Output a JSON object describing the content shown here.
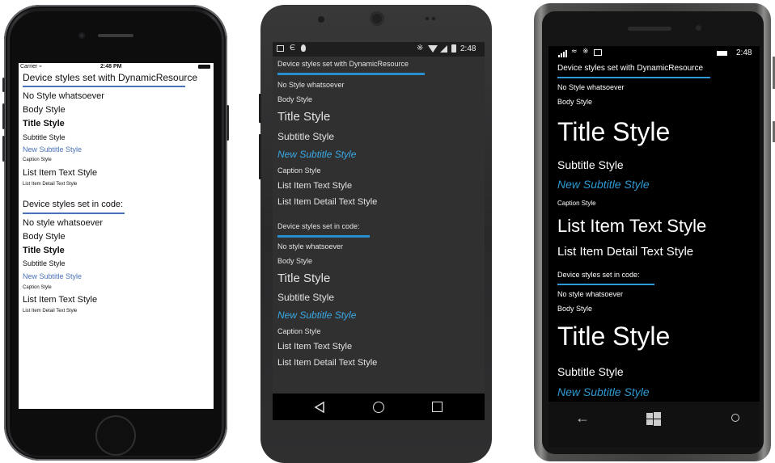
{
  "iphone": {
    "status": {
      "carrier": "Carrier",
      "time": "2:48 PM"
    },
    "section1": {
      "header": "Device styles set with DynamicResource",
      "rows": [
        "No Style whatsoever",
        "Body Style",
        "Title Style",
        "Subtitle Style",
        "New Subtitle Style",
        "Caption Style",
        "List Item Text Style",
        "List Item Detail Text Style"
      ]
    },
    "section2": {
      "header": "Device styles set in code:",
      "rows": [
        "No style whatsoever",
        "Body Style",
        "Title Style",
        "Subtitle Style",
        "New Subtitle Style",
        "Caption Style",
        "List Item Text Style",
        "List Item Detail Text Style"
      ]
    }
  },
  "android": {
    "status": {
      "time": "2:48"
    },
    "section1": {
      "header": "Device styles set with DynamicResource",
      "rows": [
        "No Style whatsoever",
        "Body Style",
        "Title Style",
        "Subtitle Style",
        "New Subtitle Style",
        "Caption Style",
        "List Item Text Style",
        "List Item Detail Text Style"
      ]
    },
    "section2": {
      "header": "Device styles set in code:",
      "rows": [
        "No style whatsoever",
        "Body Style",
        "Title Style",
        "Subtitle Style",
        "New Subtitle Style",
        "Caption Style",
        "List Item Text Style",
        "List Item Detail Text Style"
      ]
    },
    "nav": {
      "back_icon": "triangle-back-icon",
      "home_icon": "circle-home-icon",
      "recents_icon": "square-recents-icon"
    }
  },
  "winphone": {
    "status": {
      "time": "2:48"
    },
    "section1": {
      "header": "Device styles set with DynamicResource",
      "rows": [
        "No Style whatsoever",
        "Body Style",
        "Title Style",
        "Subtitle Style",
        "New Subtitle Style",
        "Caption Style",
        "List Item Text Style",
        "List Item Detail Text Style"
      ]
    },
    "section2": {
      "header": "Device styles set in code:",
      "rows": [
        "No style whatsoever",
        "Body Style",
        "Title Style",
        "Subtitle Style",
        "New Subtitle Style"
      ]
    },
    "nav": {
      "back_icon": "back-arrow-icon",
      "start_icon": "windows-start-icon",
      "search_icon": "search-icon"
    }
  },
  "colors": {
    "ios_accent": "#4a72b8",
    "android_accent": "#2a8fce",
    "android_bg": "#303030",
    "winphone_accent": "#2e9ad4"
  }
}
